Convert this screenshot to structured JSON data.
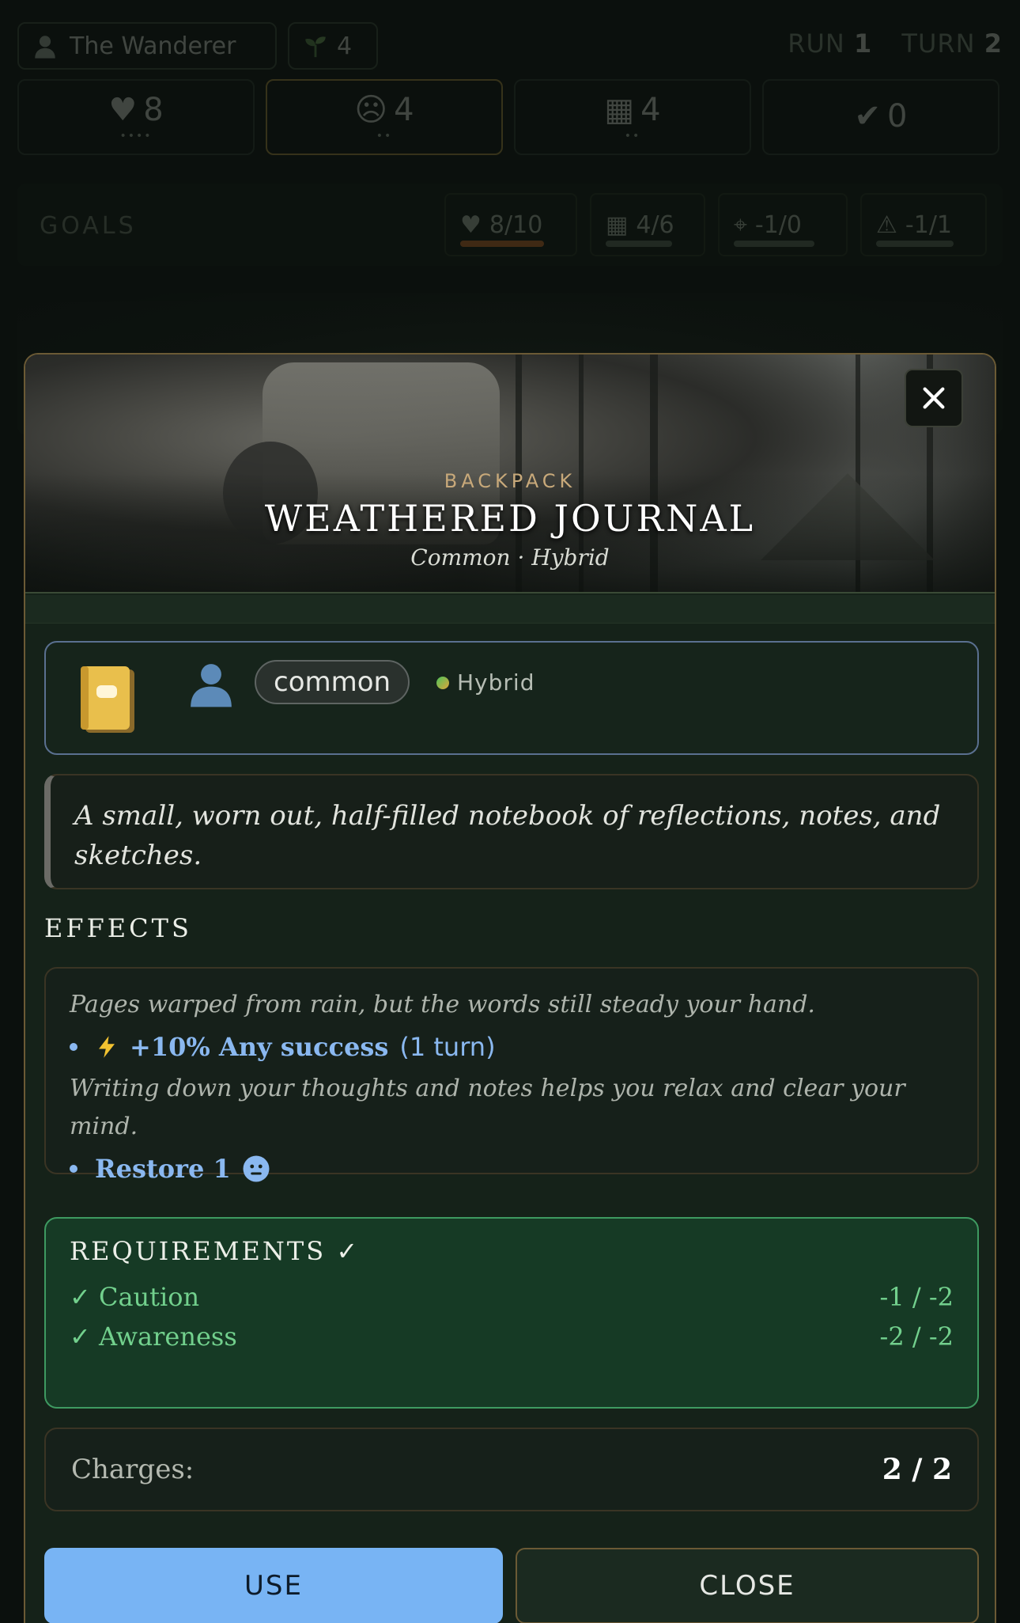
{
  "topbar": {
    "player_name": "The Wanderer",
    "sprout_count": "4",
    "run_label": "RUN",
    "run_value": "1",
    "turn_label": "TURN",
    "turn_value": "2"
  },
  "stats": [
    {
      "icon": "heart-icon",
      "value": "8",
      "dots": "••••"
    },
    {
      "icon": "face-icon",
      "value": "4",
      "dots": "••"
    },
    {
      "icon": "shelter-icon",
      "value": "4",
      "dots": "••"
    },
    {
      "icon": "check-badge-icon",
      "value": "0",
      "dots": ""
    }
  ],
  "goals": {
    "label": "GOALS",
    "items": [
      {
        "icon": "heart-icon",
        "value": "8/10"
      },
      {
        "icon": "shelter-icon",
        "value": "4/6"
      },
      {
        "icon": "pin-icon",
        "value": "-1/0"
      },
      {
        "icon": "warning-icon",
        "value": "-1/1"
      }
    ]
  },
  "modal": {
    "kicker": "BACKPACK",
    "title": "WEATHERED JOURNAL",
    "subtitle": "Common · Hybrid",
    "rarity": "common",
    "type": "Hybrid",
    "description": "A small, worn out, half-filled notebook of reflections, notes, and sketches.",
    "effects_title": "EFFECTS",
    "effects": [
      {
        "flavor": "Pages warped from rain, but the words still steady your hand.",
        "icon": "lightning-icon",
        "text": "+10% Any success",
        "suffix": "(1 turn)"
      },
      {
        "flavor": "Writing down your thoughts and notes helps you relax and clear your mind.",
        "text": "Restore 1",
        "icon": "face-icon"
      }
    ],
    "requirements_title": "REQUIREMENTS ✓",
    "requirements": [
      {
        "label": "✓ Caution",
        "value": "-1 / -2"
      },
      {
        "label": "✓ Awareness",
        "value": "-2 / -2"
      }
    ],
    "charges_label": "Charges:",
    "charges_value": "2 / 2",
    "use_label": "USE",
    "close_label": "CLOSE"
  },
  "colors": {
    "accent_blue": "#78b4f4",
    "requirement_green": "#72d08d",
    "gold_border": "#6b5a35"
  }
}
